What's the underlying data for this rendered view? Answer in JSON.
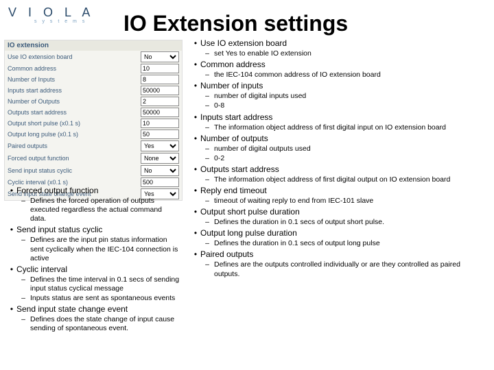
{
  "logo_text": "V I O L A",
  "logo_sub": "s y s t e m s",
  "title": "IO Extension settings",
  "panel": {
    "header": "IO extension",
    "rows": [
      {
        "label": "Use IO extension board",
        "type": "select",
        "value": "No"
      },
      {
        "label": "Common address",
        "type": "input",
        "value": "10"
      },
      {
        "label": "Number of Inputs",
        "type": "input",
        "value": "8"
      },
      {
        "label": "Inputs start address",
        "type": "input",
        "value": "50000"
      },
      {
        "label": "Number of Outputs",
        "type": "input",
        "value": "2"
      },
      {
        "label": "Outputs start address",
        "type": "input",
        "value": "50000"
      },
      {
        "label": "Output short pulse (x0.1 s)",
        "type": "input",
        "value": "10"
      },
      {
        "label": "Output long pulse (x0.1 s)",
        "type": "input",
        "value": "50"
      },
      {
        "label": "Paired outputs",
        "type": "select",
        "value": "Yes"
      },
      {
        "label": "Forced output function",
        "type": "select",
        "value": "None"
      },
      {
        "label": "Send input status cyclic",
        "type": "select",
        "value": "No"
      },
      {
        "label": "Cyclic interval (x0.1 s)",
        "type": "input",
        "value": "500"
      },
      {
        "label": "Send input state change event",
        "type": "select",
        "value": "Yes"
      }
    ]
  },
  "right_items": [
    {
      "title": "Use IO extension board",
      "subs": [
        "set Yes to enable IO extension"
      ]
    },
    {
      "title": "Common address",
      "subs": [
        "the IEC-104 common address of IO extension board"
      ]
    },
    {
      "title": "Number of inputs",
      "subs": [
        "number of digital inputs used",
        "0-8"
      ]
    },
    {
      "title": "Inputs start address",
      "subs": [
        "The information object address of first digital input on IO extension board"
      ]
    },
    {
      "title": "Number of outputs",
      "subs": [
        "number of digital outputs used",
        "0-2"
      ]
    },
    {
      "title": "Outputs start address",
      "subs": [
        "The information object address of first digital output on IO extension board"
      ]
    },
    {
      "title": "Reply end timeout",
      "subs": [
        "timeout of waiting reply to end from IEC-101 slave"
      ]
    },
    {
      "title": "Output short pulse duration",
      "subs": [
        "Defines the duration in 0.1 secs of output short pulse."
      ]
    },
    {
      "title": "Output long pulse duration",
      "subs": [
        "Defines the duration in 0.1 secs of output long pulse"
      ]
    },
    {
      "title": "Paired outputs",
      "subs": [
        "Defines are the outputs controlled individually or are they controlled as paired outputs."
      ]
    }
  ],
  "left_items": [
    {
      "title": "Forced output function",
      "subs": [
        "Defines the forced operation of outputs executed regardless the actual command data."
      ]
    },
    {
      "title": "Send input status cyclic",
      "subs": [
        "Defines are the input pin status information sent cyclically when the IEC-104 connection is active"
      ]
    },
    {
      "title": "Cyclic interval",
      "subs": [
        "Defines the time interval in 0.1 secs of sending input status cyclical message",
        "Inputs status are sent as spontaneous events"
      ]
    },
    {
      "title": "Send input state change event",
      "subs": [
        "Defines does the state change of input cause sending of spontaneous event."
      ]
    }
  ]
}
